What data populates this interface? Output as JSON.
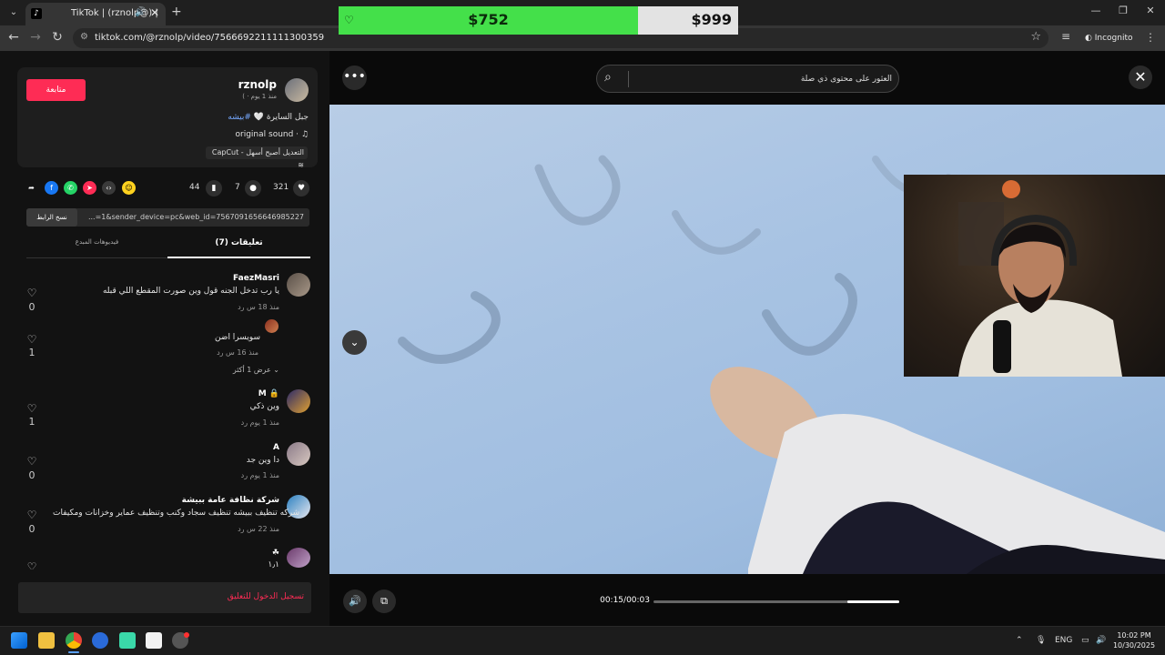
{
  "browser": {
    "tab_title": "TikTok | (rznolp@) |",
    "tab_favicon": "tiktok-icon",
    "url": "tiktok.com/@rznolp/video/7566692211111300359",
    "incognito_label": "Incognito"
  },
  "overlay": {
    "price_current": "$752",
    "price_target": "$999",
    "progress_fraction": 0.75
  },
  "post": {
    "follow_label": "متابعة",
    "username": "rznolp",
    "meta": "( · منذ 1 يوم",
    "caption_text": "جبل السايرة 🤍",
    "caption_tag": "#بيشه",
    "sound": "original sound ·",
    "capcut": "CapCut - التعديل أصبح أسهل",
    "likes": "321",
    "comments": "7",
    "saves": "44",
    "share_link": "...=1&sender_device=pc&web_id=7567091656646985227",
    "copy_link_label": "نسخ الرابط"
  },
  "tabs": {
    "comments": "(7) تعليقات",
    "creator_videos": "فيديوهات المبدع"
  },
  "comments": [
    {
      "name": "FaezMasri",
      "text": "يا رب تدخل الجنه قول وين صورت المقطع اللي قبله",
      "meta": "منذ 18 س    رد",
      "likes": "0"
    },
    {
      "name": "",
      "text": "سويسرا اضن",
      "meta": "منذ 16 س    رد",
      "likes": "1"
    },
    {
      "name": "M 🔒",
      "text": "وين ذكي",
      "meta": "منذ 1 يوم    رد",
      "likes": "1"
    },
    {
      "name": "A",
      "text": "دا وين جد",
      "meta": "منذ 1 يوم    رد",
      "likes": "0"
    },
    {
      "name": "شركة نظافة عامة ببيشة",
      "text": "شركه تنظيف ببيشه تنظيف سجاد وكنب وتنظيف عماير وخزانات ومكيفات",
      "meta": "منذ 22 س    رد",
      "likes": "0"
    },
    {
      "name": "☘",
      "text": "۱٫۱",
      "meta": "",
      "likes": ""
    }
  ],
  "show_more_replies": "عرض 1 أكثر ⌄",
  "login_prompt": "تسجيل الدخول للتعليق",
  "video": {
    "search_placeholder": "العثور على محتوى ذي صلة",
    "time": "00:15/00:03",
    "progress_fraction": 0.21
  },
  "taskbar": {
    "lang": "ENG",
    "time": "10:02 PM",
    "date": "10/30/2025"
  },
  "colors": {
    "accent": "#fe2c55",
    "price_green": "#44e04a",
    "hashtag": "#76a9ff"
  }
}
